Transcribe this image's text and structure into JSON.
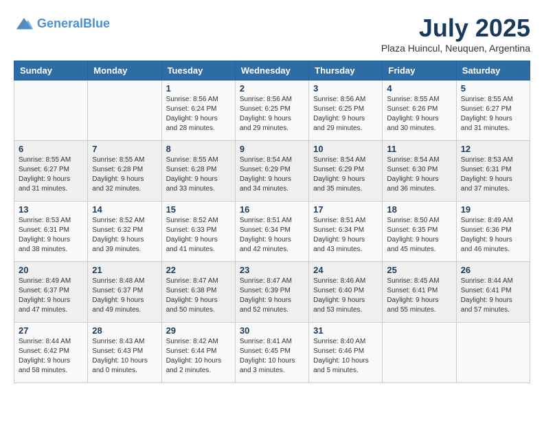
{
  "header": {
    "logo_line1": "General",
    "logo_line2": "Blue",
    "title": "July 2025",
    "subtitle": "Plaza Huincul, Neuquen, Argentina"
  },
  "weekdays": [
    "Sunday",
    "Monday",
    "Tuesday",
    "Wednesday",
    "Thursday",
    "Friday",
    "Saturday"
  ],
  "weeks": [
    [
      {
        "day": "",
        "sunrise": "",
        "sunset": "",
        "daylight": ""
      },
      {
        "day": "",
        "sunrise": "",
        "sunset": "",
        "daylight": ""
      },
      {
        "day": "1",
        "sunrise": "Sunrise: 8:56 AM",
        "sunset": "Sunset: 6:24 PM",
        "daylight": "Daylight: 9 hours and 28 minutes."
      },
      {
        "day": "2",
        "sunrise": "Sunrise: 8:56 AM",
        "sunset": "Sunset: 6:25 PM",
        "daylight": "Daylight: 9 hours and 29 minutes."
      },
      {
        "day": "3",
        "sunrise": "Sunrise: 8:56 AM",
        "sunset": "Sunset: 6:25 PM",
        "daylight": "Daylight: 9 hours and 29 minutes."
      },
      {
        "day": "4",
        "sunrise": "Sunrise: 8:55 AM",
        "sunset": "Sunset: 6:26 PM",
        "daylight": "Daylight: 9 hours and 30 minutes."
      },
      {
        "day": "5",
        "sunrise": "Sunrise: 8:55 AM",
        "sunset": "Sunset: 6:27 PM",
        "daylight": "Daylight: 9 hours and 31 minutes."
      }
    ],
    [
      {
        "day": "6",
        "sunrise": "Sunrise: 8:55 AM",
        "sunset": "Sunset: 6:27 PM",
        "daylight": "Daylight: 9 hours and 31 minutes."
      },
      {
        "day": "7",
        "sunrise": "Sunrise: 8:55 AM",
        "sunset": "Sunset: 6:28 PM",
        "daylight": "Daylight: 9 hours and 32 minutes."
      },
      {
        "day": "8",
        "sunrise": "Sunrise: 8:55 AM",
        "sunset": "Sunset: 6:28 PM",
        "daylight": "Daylight: 9 hours and 33 minutes."
      },
      {
        "day": "9",
        "sunrise": "Sunrise: 8:54 AM",
        "sunset": "Sunset: 6:29 PM",
        "daylight": "Daylight: 9 hours and 34 minutes."
      },
      {
        "day": "10",
        "sunrise": "Sunrise: 8:54 AM",
        "sunset": "Sunset: 6:29 PM",
        "daylight": "Daylight: 9 hours and 35 minutes."
      },
      {
        "day": "11",
        "sunrise": "Sunrise: 8:54 AM",
        "sunset": "Sunset: 6:30 PM",
        "daylight": "Daylight: 9 hours and 36 minutes."
      },
      {
        "day": "12",
        "sunrise": "Sunrise: 8:53 AM",
        "sunset": "Sunset: 6:31 PM",
        "daylight": "Daylight: 9 hours and 37 minutes."
      }
    ],
    [
      {
        "day": "13",
        "sunrise": "Sunrise: 8:53 AM",
        "sunset": "Sunset: 6:31 PM",
        "daylight": "Daylight: 9 hours and 38 minutes."
      },
      {
        "day": "14",
        "sunrise": "Sunrise: 8:52 AM",
        "sunset": "Sunset: 6:32 PM",
        "daylight": "Daylight: 9 hours and 39 minutes."
      },
      {
        "day": "15",
        "sunrise": "Sunrise: 8:52 AM",
        "sunset": "Sunset: 6:33 PM",
        "daylight": "Daylight: 9 hours and 41 minutes."
      },
      {
        "day": "16",
        "sunrise": "Sunrise: 8:51 AM",
        "sunset": "Sunset: 6:34 PM",
        "daylight": "Daylight: 9 hours and 42 minutes."
      },
      {
        "day": "17",
        "sunrise": "Sunrise: 8:51 AM",
        "sunset": "Sunset: 6:34 PM",
        "daylight": "Daylight: 9 hours and 43 minutes."
      },
      {
        "day": "18",
        "sunrise": "Sunrise: 8:50 AM",
        "sunset": "Sunset: 6:35 PM",
        "daylight": "Daylight: 9 hours and 45 minutes."
      },
      {
        "day": "19",
        "sunrise": "Sunrise: 8:49 AM",
        "sunset": "Sunset: 6:36 PM",
        "daylight": "Daylight: 9 hours and 46 minutes."
      }
    ],
    [
      {
        "day": "20",
        "sunrise": "Sunrise: 8:49 AM",
        "sunset": "Sunset: 6:37 PM",
        "daylight": "Daylight: 9 hours and 47 minutes."
      },
      {
        "day": "21",
        "sunrise": "Sunrise: 8:48 AM",
        "sunset": "Sunset: 6:37 PM",
        "daylight": "Daylight: 9 hours and 49 minutes."
      },
      {
        "day": "22",
        "sunrise": "Sunrise: 8:47 AM",
        "sunset": "Sunset: 6:38 PM",
        "daylight": "Daylight: 9 hours and 50 minutes."
      },
      {
        "day": "23",
        "sunrise": "Sunrise: 8:47 AM",
        "sunset": "Sunset: 6:39 PM",
        "daylight": "Daylight: 9 hours and 52 minutes."
      },
      {
        "day": "24",
        "sunrise": "Sunrise: 8:46 AM",
        "sunset": "Sunset: 6:40 PM",
        "daylight": "Daylight: 9 hours and 53 minutes."
      },
      {
        "day": "25",
        "sunrise": "Sunrise: 8:45 AM",
        "sunset": "Sunset: 6:41 PM",
        "daylight": "Daylight: 9 hours and 55 minutes."
      },
      {
        "day": "26",
        "sunrise": "Sunrise: 8:44 AM",
        "sunset": "Sunset: 6:41 PM",
        "daylight": "Daylight: 9 hours and 57 minutes."
      }
    ],
    [
      {
        "day": "27",
        "sunrise": "Sunrise: 8:44 AM",
        "sunset": "Sunset: 6:42 PM",
        "daylight": "Daylight: 9 hours and 58 minutes."
      },
      {
        "day": "28",
        "sunrise": "Sunrise: 8:43 AM",
        "sunset": "Sunset: 6:43 PM",
        "daylight": "Daylight: 10 hours and 0 minutes."
      },
      {
        "day": "29",
        "sunrise": "Sunrise: 8:42 AM",
        "sunset": "Sunset: 6:44 PM",
        "daylight": "Daylight: 10 hours and 2 minutes."
      },
      {
        "day": "30",
        "sunrise": "Sunrise: 8:41 AM",
        "sunset": "Sunset: 6:45 PM",
        "daylight": "Daylight: 10 hours and 3 minutes."
      },
      {
        "day": "31",
        "sunrise": "Sunrise: 8:40 AM",
        "sunset": "Sunset: 6:46 PM",
        "daylight": "Daylight: 10 hours and 5 minutes."
      },
      {
        "day": "",
        "sunrise": "",
        "sunset": "",
        "daylight": ""
      },
      {
        "day": "",
        "sunrise": "",
        "sunset": "",
        "daylight": ""
      }
    ]
  ]
}
